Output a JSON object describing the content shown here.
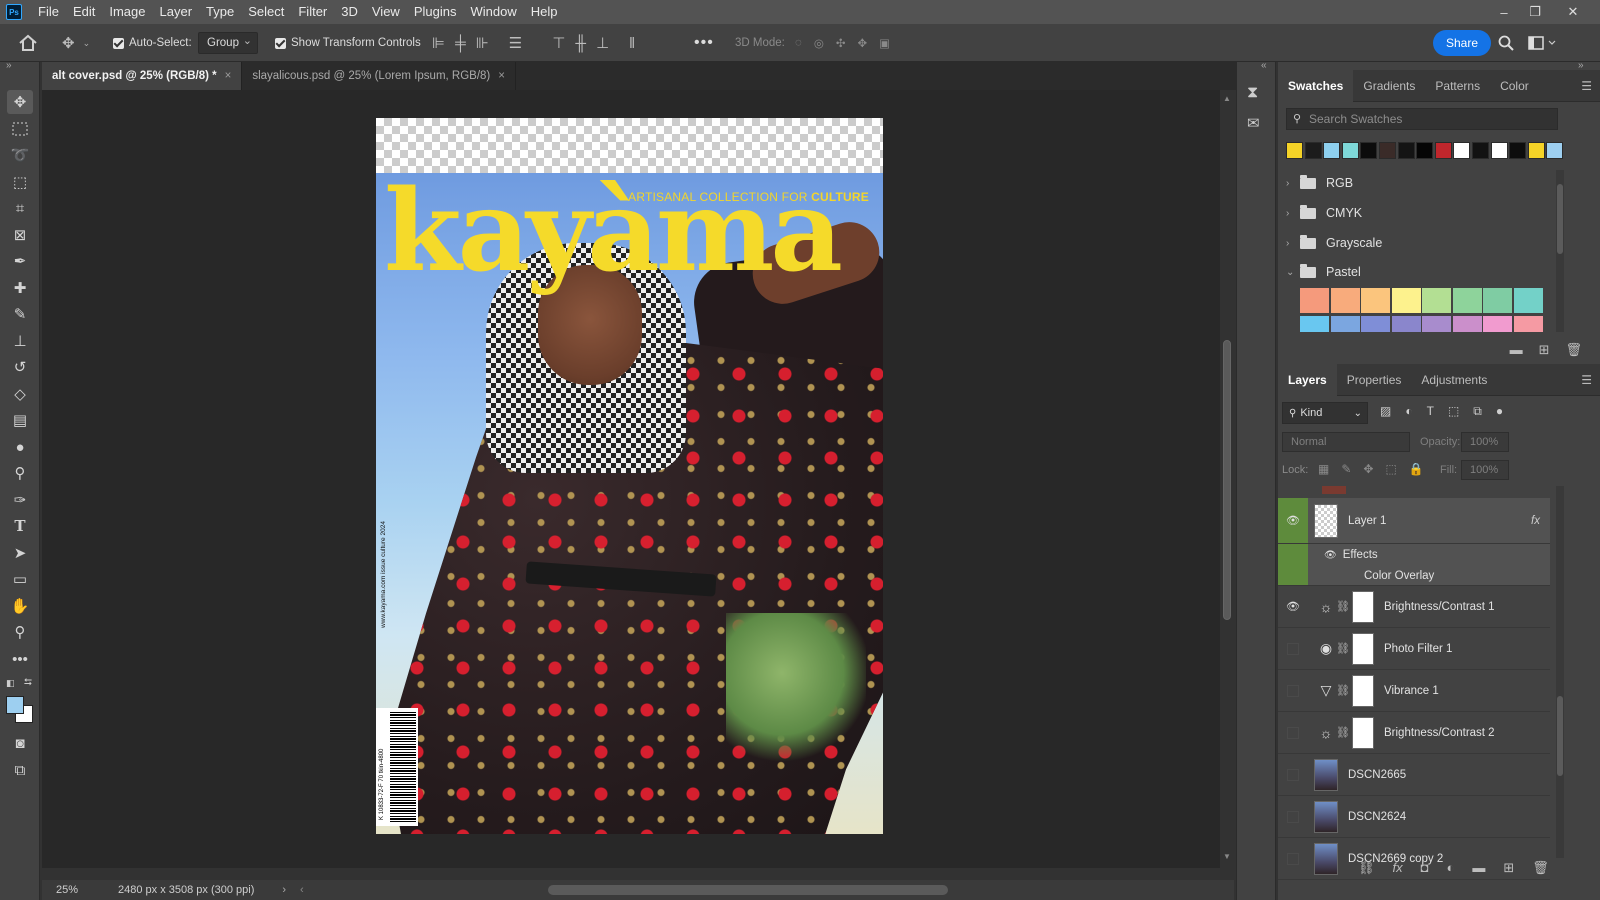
{
  "app": {
    "logo": "Ps"
  },
  "menu": [
    "File",
    "Edit",
    "Image",
    "Layer",
    "Type",
    "Select",
    "Filter",
    "3D",
    "View",
    "Plugins",
    "Window",
    "Help"
  ],
  "window_controls": {
    "minimize": "–",
    "restore": "❐",
    "close": "✕"
  },
  "options": {
    "auto_select_label": "Auto-Select:",
    "auto_select_checked": true,
    "auto_select_value": "Group",
    "show_transform_label": "Show Transform Controls",
    "show_transform_checked": true,
    "more": "•••",
    "mode_3d_label": "3D Mode:",
    "share_label": "Share"
  },
  "tabs": [
    {
      "label": "alt cover.psd @ 25% (RGB/8) *",
      "active": true,
      "close": "×"
    },
    {
      "label": "slayalicous.psd @ 25% (Lorem Ipsum, RGB/8)",
      "active": false,
      "close": "×"
    }
  ],
  "cover": {
    "title": "kayàma",
    "tagline_prefix": "ARTISANAL COLLECTION FOR ",
    "tagline_bold": "CULTURE",
    "spine_text": "www.kayama.com    issue culture 2024",
    "barcode_digits": "K 10833-72-F 70 tkin-4800"
  },
  "status": {
    "zoom": "25%",
    "doc_info": "2480 px x 3508 px (300 ppi)",
    "arrow": "›",
    "scroll_left": "‹"
  },
  "swatches_panel": {
    "tabs": [
      "Swatches",
      "Gradients",
      "Patterns",
      "Color"
    ],
    "active_tab": "Swatches",
    "search_placeholder": "Search Swatches",
    "recent_colors": [
      "#f5d327",
      "#1c1c1c",
      "#8ed0ef",
      "#7ed8d8",
      "#0c0c0c",
      "#3a2b28",
      "#141414",
      "#050505",
      "#c0262c",
      "#ffffff",
      "#121212",
      "#ffffff",
      "#0d0d0d",
      "#f5d327",
      "#9dcff0"
    ],
    "groups": [
      {
        "name": "RGB",
        "expanded": false
      },
      {
        "name": "CMYK",
        "expanded": false
      },
      {
        "name": "Grayscale",
        "expanded": false
      },
      {
        "name": "Pastel",
        "expanded": true
      }
    ],
    "pastel_colors": [
      "#f59a7c",
      "#f8ab7c",
      "#fbc57d",
      "#fdf28d",
      "#b3df93",
      "#8ed39b",
      "#7fcca3",
      "#73d1c8",
      "#69c7f0",
      "#7ba6e0",
      "#7f8ed7",
      "#8a86cc",
      "#a88ccd",
      "#cb8fcb",
      "#f19bcf",
      "#f59aa3"
    ]
  },
  "layers_panel": {
    "tabs": [
      "Layers",
      "Properties",
      "Adjustments"
    ],
    "active_tab": "Layers",
    "filter_kind": "Kind",
    "blend_mode": "Normal",
    "opacity_label": "Opacity:",
    "opacity_value": "100%",
    "lock_label": "Lock:",
    "fill_label": "Fill:",
    "fill_value": "100%",
    "fx_label": "fx",
    "effects_label": "Effects",
    "color_overlay_label": "Color Overlay",
    "layers": [
      {
        "name": "Layer 1",
        "type": "pixel",
        "visible": true,
        "selected": true
      },
      {
        "name": "Brightness/Contrast 1",
        "type": "adjustment",
        "icon": "brightness-icon",
        "visible": true
      },
      {
        "name": "Photo Filter 1",
        "type": "adjustment",
        "icon": "photo-filter-icon",
        "visible": false
      },
      {
        "name": "Vibrance 1",
        "type": "adjustment",
        "icon": "vibrance-icon",
        "visible": false
      },
      {
        "name": "Brightness/Contrast 2",
        "type": "adjustment",
        "icon": "brightness-icon",
        "visible": false
      },
      {
        "name": "DSCN2665",
        "type": "image",
        "visible": false
      },
      {
        "name": "DSCN2624",
        "type": "image",
        "visible": false
      },
      {
        "name": "DSCN2669 copy 2",
        "type": "image",
        "visible": false
      }
    ]
  },
  "colors": {
    "accent": "#1473e6",
    "selected_layer": "#5e8b3c",
    "cover_title": "#f5da2a",
    "foreground": "#9dcff0",
    "background": "#ffffff"
  }
}
